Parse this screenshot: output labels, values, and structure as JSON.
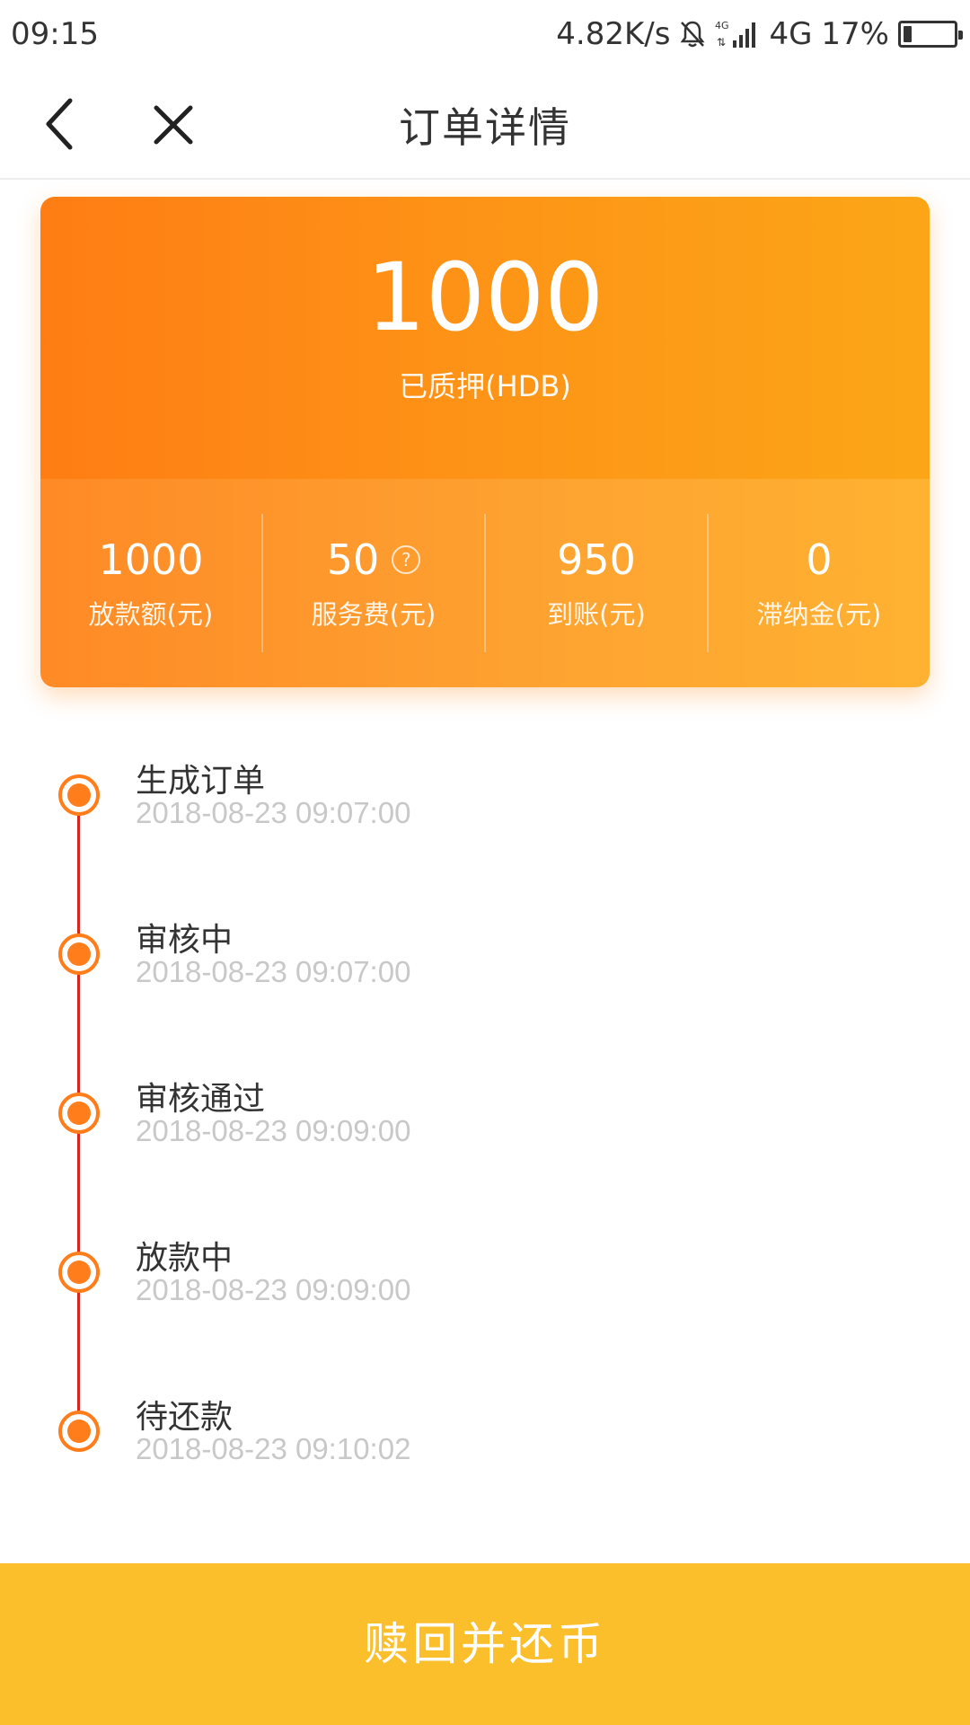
{
  "status_bar": {
    "time": "09:15",
    "network_speed": "4.82K/s",
    "mute_icon": "bell-off-icon",
    "signal_icon": "signal-4g-icon",
    "network_type": "4G",
    "battery_percent": "17%",
    "battery_level": 0.17
  },
  "nav": {
    "back_icon": "chevron-left-icon",
    "close_icon": "close-icon",
    "title": "订单详情"
  },
  "summary": {
    "pledged_amount": "1000",
    "pledged_label": "已质押(HDB)",
    "stats": [
      {
        "value": "1000",
        "label": "放款额(元)"
      },
      {
        "value": "50",
        "label": "服务费(元)",
        "has_help_icon": true
      },
      {
        "value": "950",
        "label": "到账(元)"
      },
      {
        "value": "0",
        "label": "滞纳金(元)"
      }
    ],
    "help_icon_glyph": "?"
  },
  "timeline": [
    {
      "title": "生成订单",
      "time": "2018-08-23 09:07:00"
    },
    {
      "title": "审核中",
      "time": "2018-08-23 09:07:00"
    },
    {
      "title": "审核通过",
      "time": "2018-08-23 09:09:00"
    },
    {
      "title": "放款中",
      "time": "2018-08-23 09:09:00"
    },
    {
      "title": "待还款",
      "time": "2018-08-23 09:10:02"
    }
  ],
  "action_button": {
    "label": "赎回并还币"
  },
  "colors": {
    "accent_orange": "#ff7d1a",
    "timeline_line": "#d9261c",
    "button_yellow": "#fbbf2c"
  }
}
